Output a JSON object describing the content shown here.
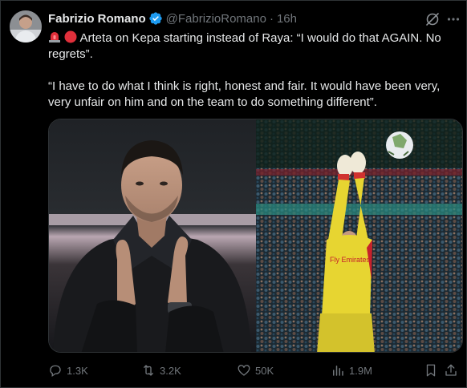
{
  "author": {
    "name": "Fabrizio Romano",
    "handle": "@FabrizioRomano",
    "separator": "·",
    "time": "16h"
  },
  "tweet": {
    "line1": "Arteta on Kepa starting instead of Raya: “I would do that AGAIN. No regrets”.",
    "line2": "“I have to do what I think is right, honest and fair. It would have been very, very unfair on him and on the team to do something different”."
  },
  "media": {
    "left_image": "Mikel Arteta applauding in black coat",
    "right_image": "Goalkeeper in yellow Arsenal kit leaping to catch ball",
    "jersey_text": "Fly Emirates"
  },
  "actions": {
    "replies": "1.3K",
    "reposts": "3.2K",
    "likes": "50K",
    "views": "1.9M"
  },
  "icons": {
    "verified": "verified-badge-icon",
    "grok": "grok-icon",
    "more": "more-icon",
    "reply": "reply-icon",
    "repost": "repost-icon",
    "like": "like-icon",
    "views": "views-icon",
    "bookmark": "bookmark-icon",
    "share": "share-icon"
  },
  "colors": {
    "background": "#000000",
    "text": "#e7e9ea",
    "muted": "#71767b",
    "verified": "#1d9bf0",
    "kit_yellow": "#e7d531"
  }
}
